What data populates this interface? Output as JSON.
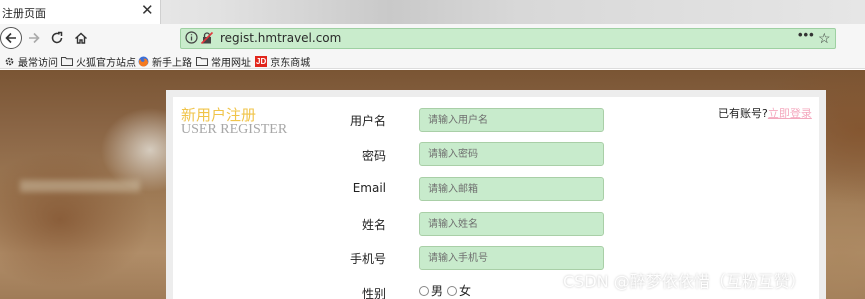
{
  "tab": {
    "title": "注册页面",
    "close": "✕"
  },
  "nav": {
    "url_host": "regist.hmtravel.com",
    "more": "•••",
    "star": "☆"
  },
  "bookmarks": [
    {
      "label": "最常访问",
      "icon": "gear-icon"
    },
    {
      "label": "火狐官方站点",
      "icon": "folder-icon"
    },
    {
      "label": "新手上路",
      "icon": "firefox-icon"
    },
    {
      "label": "常用网址",
      "icon": "folder-icon"
    },
    {
      "label": "京东商城",
      "icon": "jd-icon",
      "icon_text": "JD"
    }
  ],
  "form": {
    "title": "新用户注册",
    "subtitle": "USER REGISTER",
    "login_prompt": "已有账号?",
    "login_link": "立即登录",
    "fields": [
      {
        "label": "用户名",
        "placeholder": "请输入用户名"
      },
      {
        "label": "密码",
        "placeholder": "请输入密码"
      },
      {
        "label": "Email",
        "placeholder": "请输入邮箱"
      },
      {
        "label": "姓名",
        "placeholder": "请输入姓名"
      },
      {
        "label": "手机号",
        "placeholder": "请输入手机号"
      }
    ],
    "gender_label": "性别",
    "gender_options": [
      "男",
      "女"
    ]
  },
  "watermark": "CSDN @醉梦依依惜（互粉互赞）",
  "colors": {
    "urlbar": "#c9eccc",
    "input_bg": "#c8ebcc",
    "title": "#f0c44a",
    "link": "#f4a8be"
  }
}
